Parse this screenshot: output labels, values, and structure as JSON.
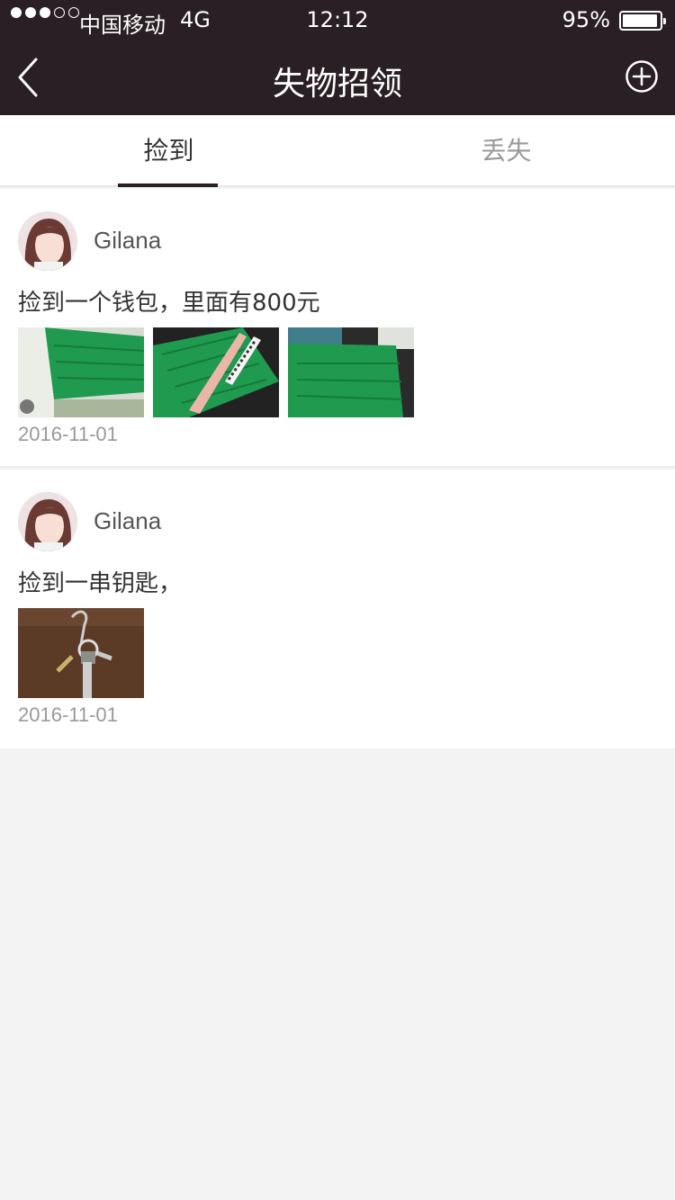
{
  "status_bar": {
    "carrier": "中国移动",
    "network": "4G",
    "time": "12:12",
    "battery_percent": "95%",
    "signal_strength": 3,
    "signal_max": 5,
    "battery_level": 0.95
  },
  "nav": {
    "title": "失物招领",
    "back_icon": "chevron-left-icon",
    "add_icon": "plus-circle-icon"
  },
  "tabs": [
    {
      "label": "捡到",
      "selected": true
    },
    {
      "label": "丢失",
      "selected": false
    }
  ],
  "posts": [
    {
      "username": "Gilana",
      "text": "捡到一个钱包，里面有800元",
      "date": "2016-11-01",
      "photo_count": 3
    },
    {
      "username": "Gilana",
      "text": "捡到一串钥匙，",
      "date": "2016-11-01",
      "photo_count": 1
    }
  ],
  "colors": {
    "header_bg": "#2a1f24",
    "page_bg": "#f3f3f3",
    "accent_indicator": "#2a1f24",
    "wallet_green": "#1f9a4f"
  }
}
